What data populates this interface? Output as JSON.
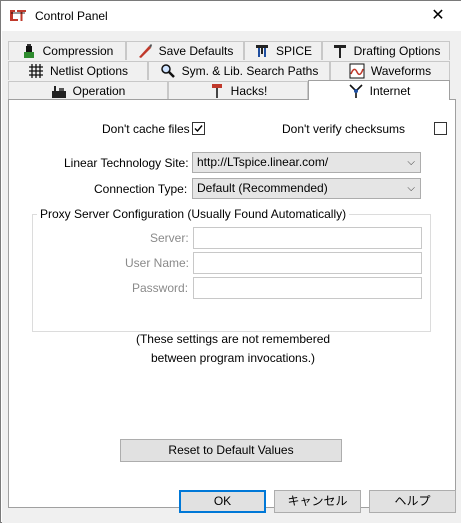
{
  "window": {
    "title": "Control Panel",
    "close_glyph": "✕"
  },
  "tabs": {
    "row1": [
      {
        "label": "Compression",
        "icon": "compression-icon"
      },
      {
        "label": "Save Defaults",
        "icon": "save-defaults-icon"
      },
      {
        "label": "SPICE",
        "icon": "spice-icon"
      },
      {
        "label": "Drafting Options",
        "icon": "drafting-icon"
      }
    ],
    "row2": [
      {
        "label": "Netlist Options",
        "icon": "netlist-icon"
      },
      {
        "label": "Sym. & Lib. Search Paths",
        "icon": "search-paths-icon"
      },
      {
        "label": "Waveforms",
        "icon": "waveforms-icon"
      }
    ],
    "row3": [
      {
        "label": "Operation",
        "icon": "operation-icon"
      },
      {
        "label": "Hacks!",
        "icon": "hacks-icon"
      },
      {
        "label": "Internet",
        "icon": "internet-icon",
        "active": true
      }
    ]
  },
  "internet": {
    "dont_cache": {
      "label": "Don't cache files",
      "checked": true
    },
    "dont_verify": {
      "label": "Don't verify checksums",
      "checked": false
    },
    "site": {
      "label": "Linear Technology Site:",
      "value": "http://LTspice.linear.com/"
    },
    "connection": {
      "label": "Connection Type:",
      "value": "Default (Recommended)"
    },
    "proxy": {
      "legend": "Proxy Server Configuration (Usually Found Automatically)",
      "server_label": "Server:",
      "user_label": "User Name:",
      "password_label": "Password:",
      "server_value": "",
      "user_value": "",
      "password_value": ""
    },
    "note_line1": "(These settings are not remembered",
    "note_line2": "between program invocations.)",
    "reset_label": "Reset to Default Values"
  },
  "buttons": {
    "ok": "OK",
    "cancel": "キャンセル",
    "help": "ヘルプ"
  },
  "colors": {
    "accent": "#0078d7",
    "checkmark": "#000000"
  }
}
